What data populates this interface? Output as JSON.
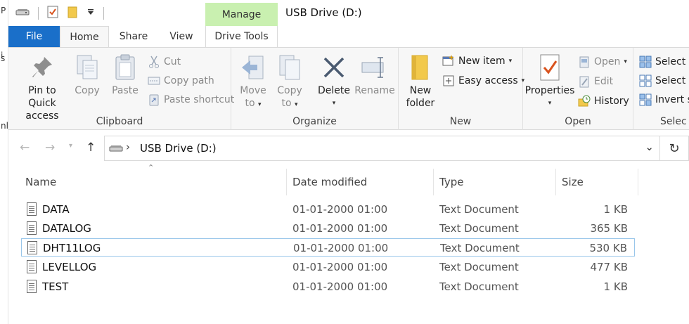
{
  "window": {
    "manage_tab": "Manage",
    "title": "USB Drive (D:)"
  },
  "left_strip": [
    "P",
    "i",
    "s",
    "nl"
  ],
  "tabs": {
    "file": "File",
    "home": "Home",
    "share": "Share",
    "view": "View",
    "drive_tools": "Drive Tools"
  },
  "ribbon": {
    "clipboard": {
      "label": "Clipboard",
      "pin": "Pin to Quick access",
      "pin_line1": "Pin to Quick",
      "pin_line2": "access",
      "copy": "Copy",
      "paste": "Paste",
      "cut": "Cut",
      "copy_path": "Copy path",
      "paste_shortcut": "Paste shortcut"
    },
    "organize": {
      "label": "Organize",
      "move_to_l1": "Move",
      "move_to_l2": "to",
      "copy_to_l1": "Copy",
      "copy_to_l2": "to",
      "delete": "Delete",
      "rename": "Rename"
    },
    "new": {
      "label": "New",
      "new_folder_l1": "New",
      "new_folder_l2": "folder",
      "new_item": "New item",
      "easy_access": "Easy access"
    },
    "open": {
      "label": "Open",
      "properties": "Properties",
      "open": "Open",
      "edit": "Edit",
      "history": "History"
    },
    "select": {
      "label": "Selec",
      "select_all": "Select al",
      "select_none": "Select n",
      "invert": "Invert se"
    }
  },
  "address": {
    "path": "USB Drive (D:)"
  },
  "columns": {
    "name": "Name",
    "date": "Date modified",
    "type": "Type",
    "size": "Size"
  },
  "files": [
    {
      "name": "DATA",
      "date": "01-01-2000 01:00",
      "type": "Text Document",
      "size": "1 KB"
    },
    {
      "name": "DATALOG",
      "date": "01-01-2000 01:00",
      "type": "Text Document",
      "size": "365 KB"
    },
    {
      "name": "DHT11LOG",
      "date": "01-01-2000 01:00",
      "type": "Text Document",
      "size": "530 KB"
    },
    {
      "name": "LEVELLOG",
      "date": "01-01-2000 01:00",
      "type": "Text Document",
      "size": "477 KB"
    },
    {
      "name": "TEST",
      "date": "01-01-2000 01:00",
      "type": "Text Document",
      "size": "1 KB"
    }
  ],
  "colors": {
    "file_tab": "#1a6fc9",
    "manage_tab": "#c9f0b0",
    "ribbon_bg": "#f7f7f7",
    "selection_border": "#99c6ea"
  }
}
